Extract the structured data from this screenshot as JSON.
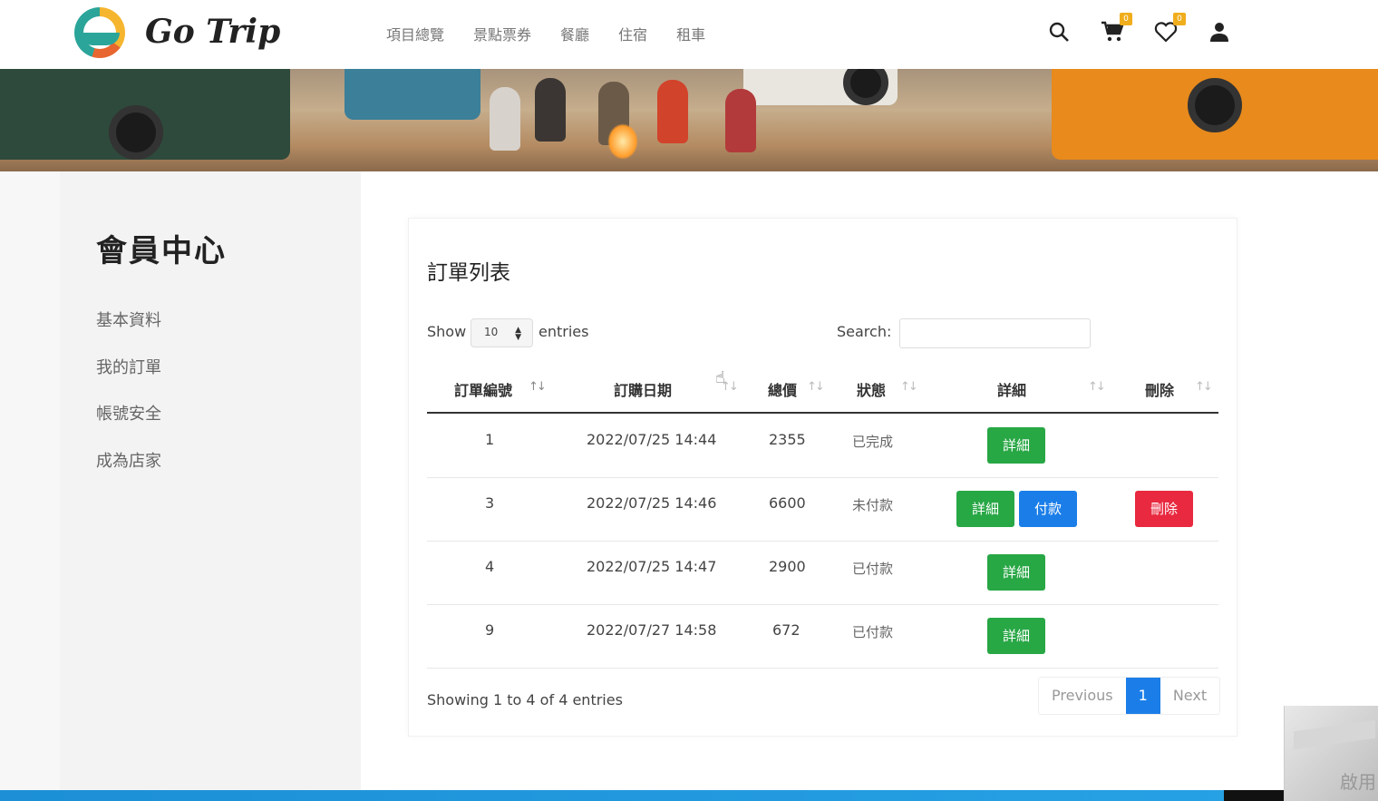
{
  "header": {
    "brand": "Go Trip",
    "nav": [
      "項目總覽",
      "景點票券",
      "餐廳",
      "住宿",
      "租車"
    ],
    "icons": {
      "search": "search-icon",
      "cart": "cart-icon",
      "cart_badge": "0",
      "wishlist": "heart-icon",
      "wishlist_badge": "0",
      "user": "user-icon"
    }
  },
  "sidebar": {
    "title": "會員中心",
    "items": [
      "基本資料",
      "我的訂單",
      "帳號安全",
      "成為店家"
    ]
  },
  "orders": {
    "title": "訂單列表",
    "show_label": "Show",
    "page_size": "10",
    "entries_label": "entries",
    "search_label": "Search:",
    "search_value": "",
    "columns": [
      "訂單編號",
      "訂購日期",
      "總價",
      "狀態",
      "詳細",
      "刪除"
    ],
    "rows": [
      {
        "id": "1",
        "date": "2022/07/25 14:44",
        "total": "2355",
        "status": "已完成",
        "actions": [
          "詳細"
        ],
        "delete": ""
      },
      {
        "id": "3",
        "date": "2022/07/25 14:46",
        "total": "6600",
        "status": "未付款",
        "actions": [
          "詳細",
          "付款"
        ],
        "delete": "刪除"
      },
      {
        "id": "4",
        "date": "2022/07/25 14:47",
        "total": "2900",
        "status": "已付款",
        "actions": [
          "詳細"
        ],
        "delete": ""
      },
      {
        "id": "9",
        "date": "2022/07/27 14:58",
        "total": "672",
        "status": "已付款",
        "actions": [
          "詳細"
        ],
        "delete": ""
      }
    ],
    "info": "Showing 1 to 4 of 4 entries",
    "pagination": {
      "prev": "Previous",
      "current": "1",
      "next": "Next"
    }
  },
  "corner_text": "啟用",
  "colors": {
    "detail_button": "#28a745",
    "pay_button": "#1b7ee8",
    "delete_button": "#e8293f",
    "badge": "#f0ad1c"
  }
}
